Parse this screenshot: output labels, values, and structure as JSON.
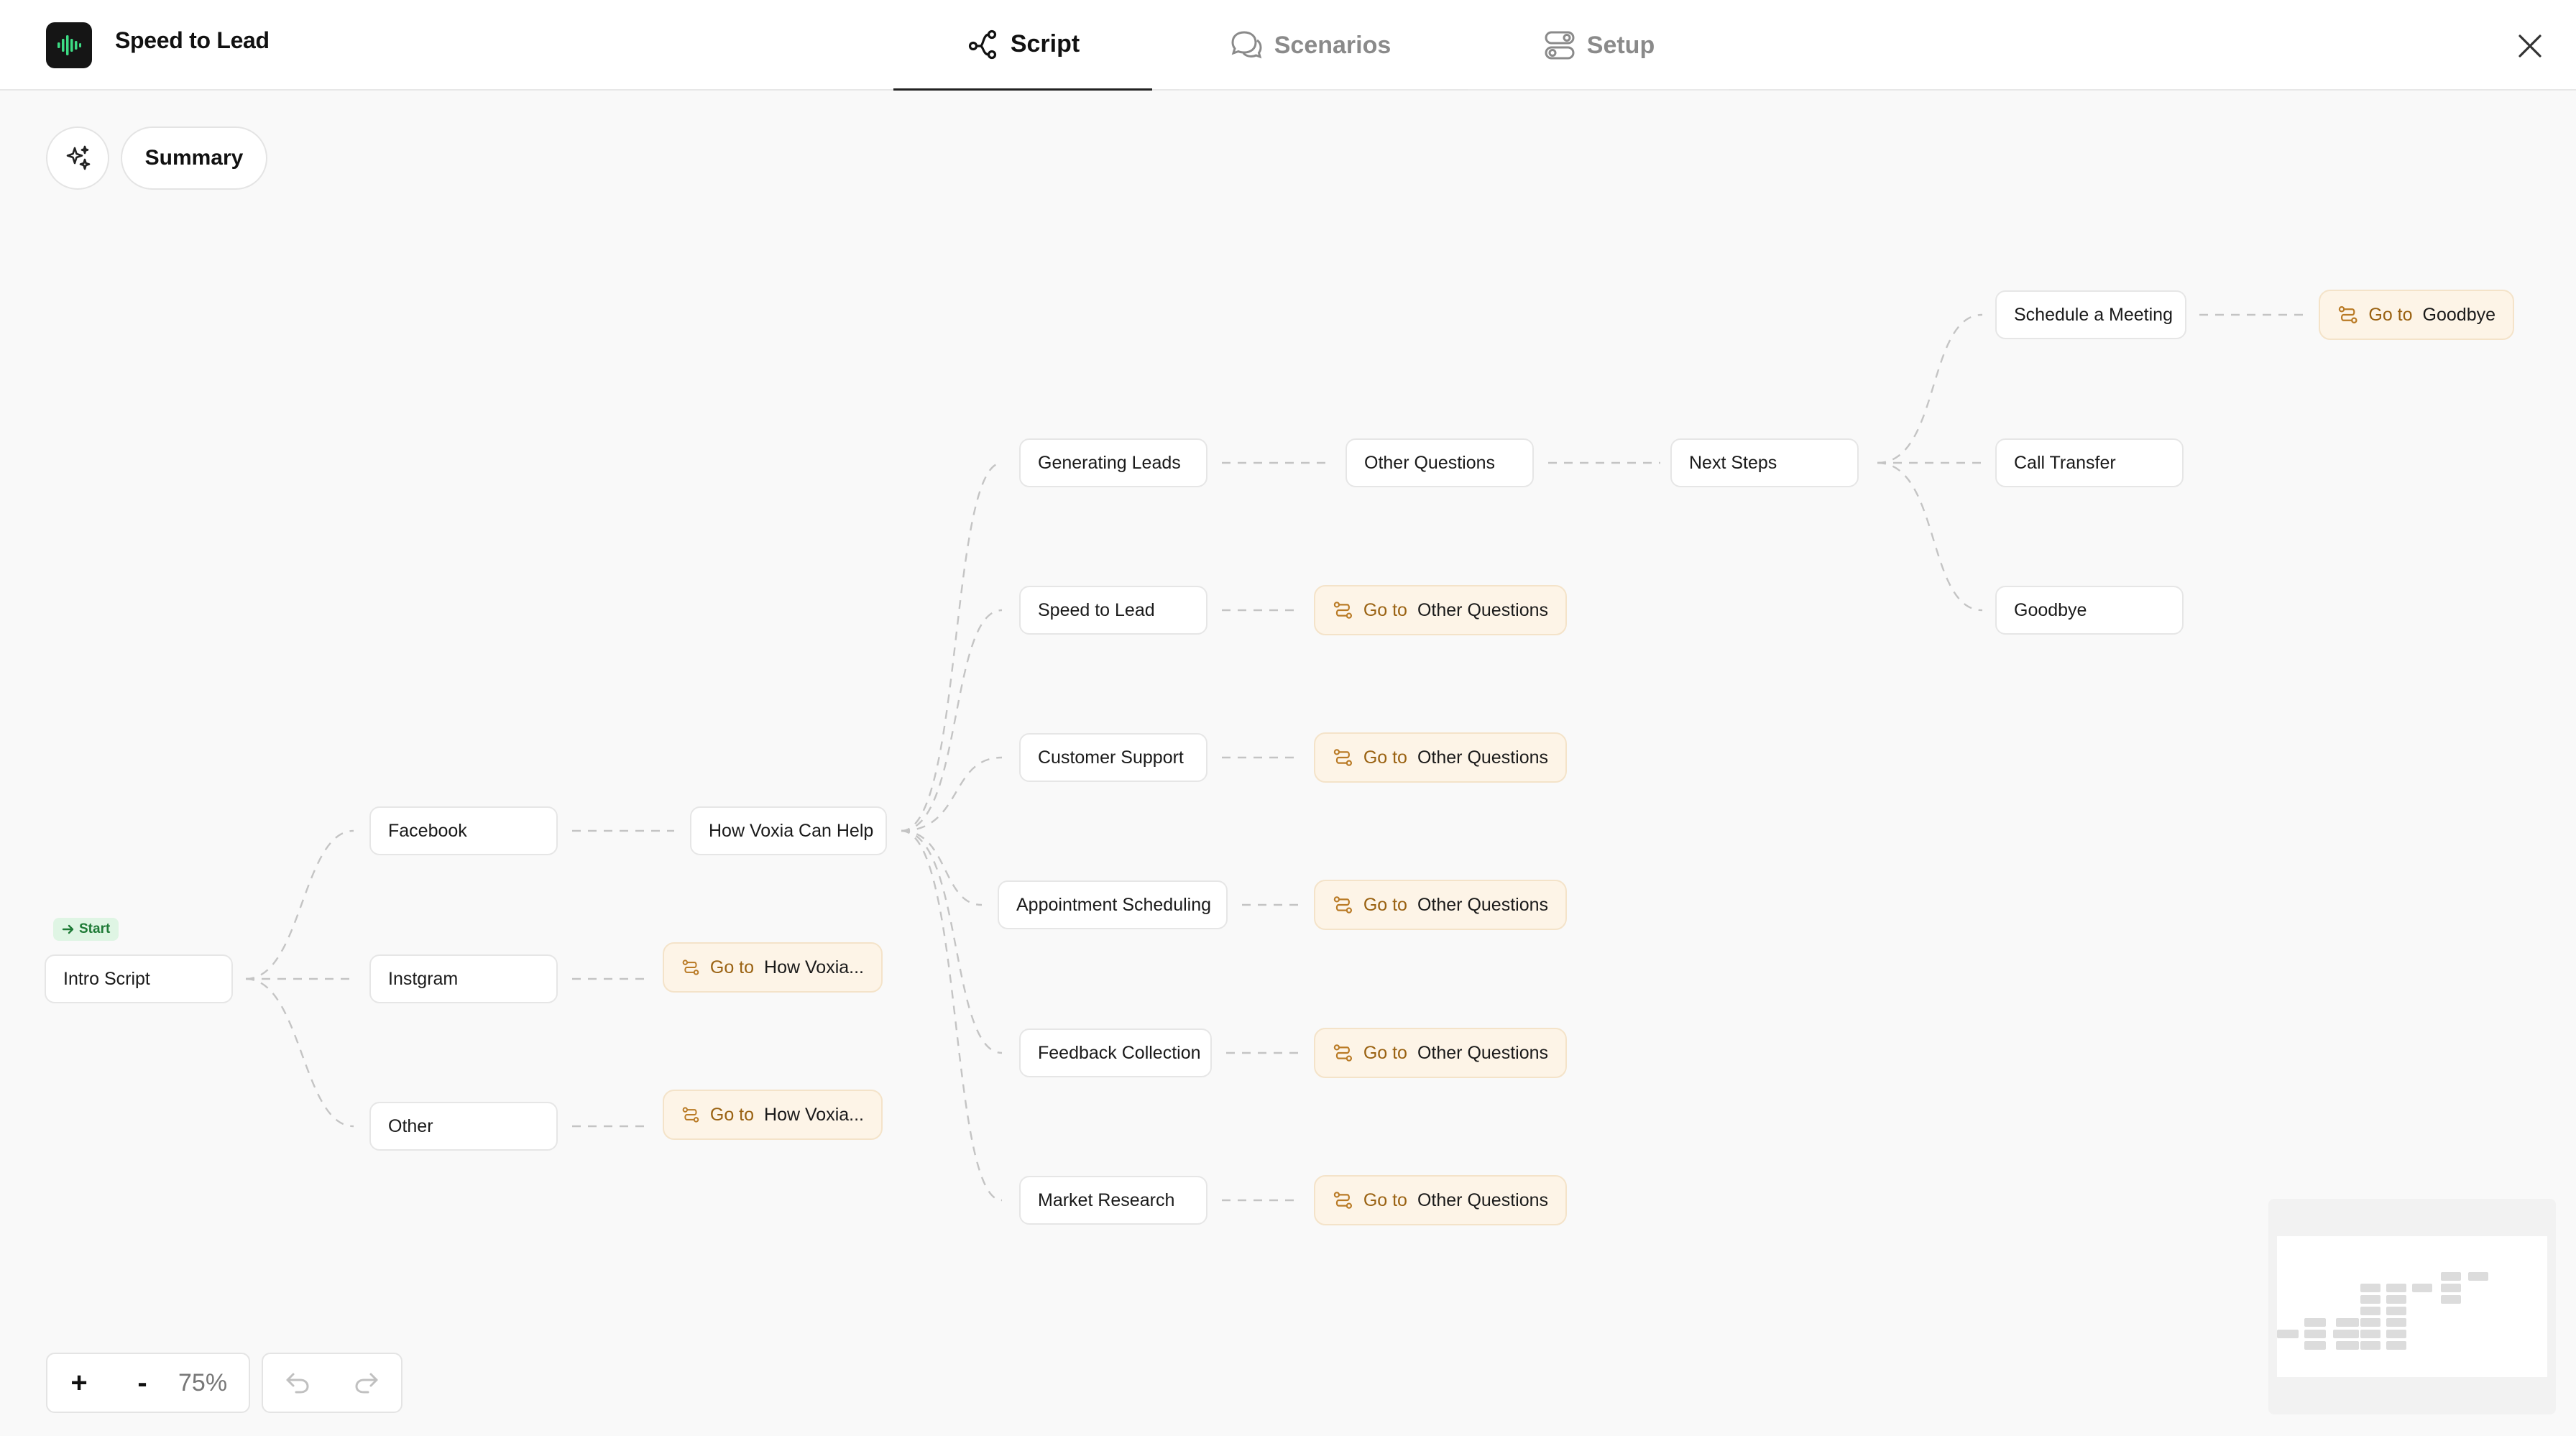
{
  "app": {
    "title": "Speed to Lead",
    "logo_icon": "sound-wave-icon",
    "logo_accent": "#3ddc84"
  },
  "tabs": [
    {
      "label": "Script",
      "icon": "branch-icon",
      "active": true
    },
    {
      "label": "Scenarios",
      "icon": "chat-bubbles-icon",
      "active": false
    },
    {
      "label": "Setup",
      "icon": "toggles-icon",
      "active": false
    }
  ],
  "toolbar": {
    "sparkle_icon": "sparkles-icon",
    "summary_label": "Summary"
  },
  "flow": {
    "start_label": "Start",
    "goto_prefix": "Go to",
    "nodes": {
      "intro": "Intro Script",
      "facebook": "Facebook",
      "instagram": "Instgram",
      "other": "Other",
      "how_voxia": "How Voxia Can Help",
      "generating_leads": "Generating Leads",
      "speed_to_lead": "Speed to Lead",
      "customer_support": "Customer Support",
      "appointment_scheduling": "Appointment Scheduling",
      "feedback_collection": "Feedback Collection",
      "market_research": "Market Research",
      "other_questions": "Other Questions",
      "next_steps": "Next Steps",
      "schedule_meeting": "Schedule a Meeting",
      "call_transfer": "Call Transfer",
      "goodbye": "Goodbye"
    },
    "gotos": {
      "instagram_target": "How Voxia...",
      "other_target": "How Voxia...",
      "speed_to_lead_target": "Other Questions",
      "customer_support_target": "Other Questions",
      "appointment_target": "Other Questions",
      "feedback_target": "Other Questions",
      "market_research_target": "Other Questions",
      "schedule_meeting_target": "Goodbye"
    },
    "colors": {
      "goto_background": "#fdf4e7",
      "goto_text": "#9a6212",
      "start_badge": "#dff5e4",
      "edge": "#c4c4c4"
    }
  },
  "zoom": {
    "plus_label": "+",
    "minus_label": "-",
    "level": "75%",
    "undo_icon": "undo-icon",
    "redo_icon": "redo-icon"
  },
  "close_icon": "close-icon"
}
